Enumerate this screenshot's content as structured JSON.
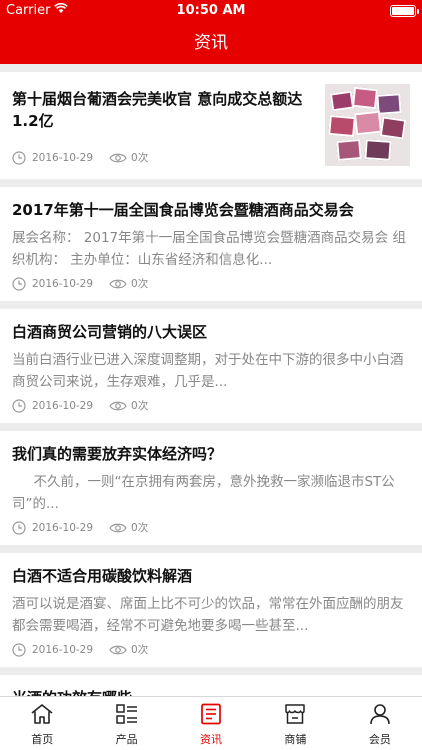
{
  "status_bar": {
    "carrier": "Carrier",
    "time": "10:50 AM"
  },
  "nav": {
    "title": "资讯"
  },
  "articles": [
    {
      "title": "第十届烟台葡酒会完美收官 意向成交总额达1.2亿",
      "summary": "",
      "date": "2016-10-29",
      "views": "0次",
      "has_image": true
    },
    {
      "title": "2017年第十一届全国食品博览会暨糖酒商品交易会",
      "summary": "展会名称： 2017年第十一届全国食品博览会暨糖酒商品交易会 组织机构： 主办单位：山东省经济和信息化...",
      "date": "2016-10-29",
      "views": "0次"
    },
    {
      "title": "白酒商贸公司营销的八大误区",
      "summary": " 当前白酒行业已进入深度调整期，对于处在中下游的很多中小白酒商贸公司来说，生存艰难，几乎是...",
      "date": "2016-10-29",
      "views": "0次"
    },
    {
      "title": "我们真的需要放弃实体经济吗？",
      "summary": "     不久前，一则“在京拥有两套房，意外挽救一家濒临退市ST公司”的...",
      "date": "2016-10-29",
      "views": "0次"
    },
    {
      "title": "白酒不适合用碳酸饮料解酒",
      "summary": "酒可以说是酒宴、席面上比不可少的饮品，常常在外面应酬的朋友都会需要喝酒，经常不可避免地要多喝一些甚至...",
      "date": "2016-10-29",
      "views": "0次"
    },
    {
      "title": "米酒的功效有哪些",
      "summary": "",
      "date": "",
      "views": ""
    }
  ],
  "tabs": [
    {
      "label": "首页",
      "icon": "home-icon"
    },
    {
      "label": "产品",
      "icon": "list-icon"
    },
    {
      "label": "资讯",
      "icon": "document-icon",
      "active": true
    },
    {
      "label": "商铺",
      "icon": "shop-icon"
    },
    {
      "label": "会员",
      "icon": "user-icon"
    }
  ],
  "colors": {
    "brand": "#e60000",
    "background": "#ececec",
    "muted": "#888888"
  }
}
